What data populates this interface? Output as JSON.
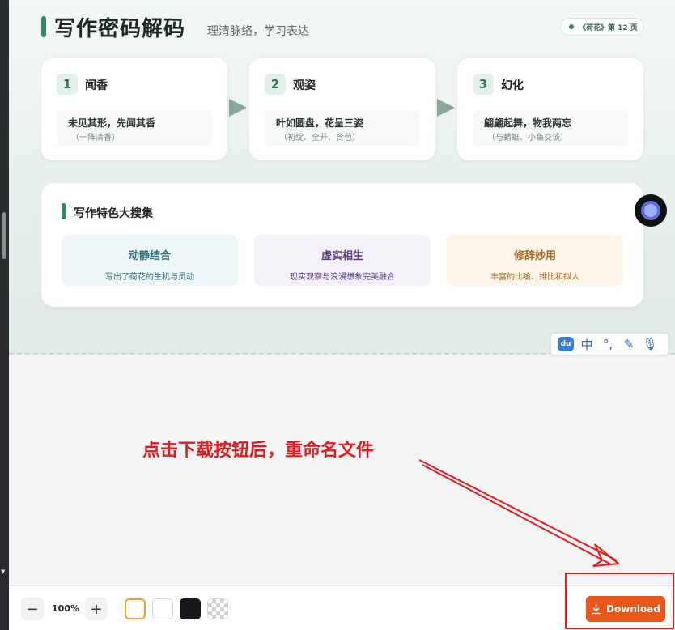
{
  "header": {
    "title": "写作密码解码",
    "subtitle": "理清脉络，学习表达",
    "badge": "《荷花》第 12 页"
  },
  "steps": [
    {
      "num": "1",
      "name": "闻香",
      "line1": "未见其形，先闻其香",
      "line2": "（一阵清香）"
    },
    {
      "num": "2",
      "name": "观姿",
      "line1": "叶如圆盘，花呈三姿",
      "line2": "（初绽、全开、含苞）"
    },
    {
      "num": "3",
      "name": "幻化",
      "line1": "翩翩起舞，物我两忘",
      "line2": "（与蜻蜓、小鱼交谈）"
    }
  ],
  "features": {
    "title": "写作特色大搜集",
    "items": [
      {
        "name": "动静结合",
        "desc": "写出了荷花的生机与灵动",
        "bg": "#eef6f7",
        "color": "#2e6f7e"
      },
      {
        "name": "虚实相生",
        "desc": "现实观察与浪漫想象完美融合",
        "bg": "#f4f1f8",
        "color": "#5a3f86"
      },
      {
        "name": "修辞妙用",
        "desc": "丰富的比喻、排比和拟人",
        "bg": "#fdf6e9",
        "color": "#a8641c"
      }
    ]
  },
  "ime": {
    "du": "du",
    "lang": "中",
    "punct": "°,",
    "pen": "✎",
    "mic": "🎙"
  },
  "annotation": "点击下载按钮后，重命名文件",
  "toolbar": {
    "zoom_out": "−",
    "zoom": "100%",
    "zoom_in": "+",
    "download": "Download",
    "swatches": [
      "#ffffff",
      "#ffffff",
      "#16181c",
      "checker"
    ],
    "accent": "#e8561b"
  }
}
